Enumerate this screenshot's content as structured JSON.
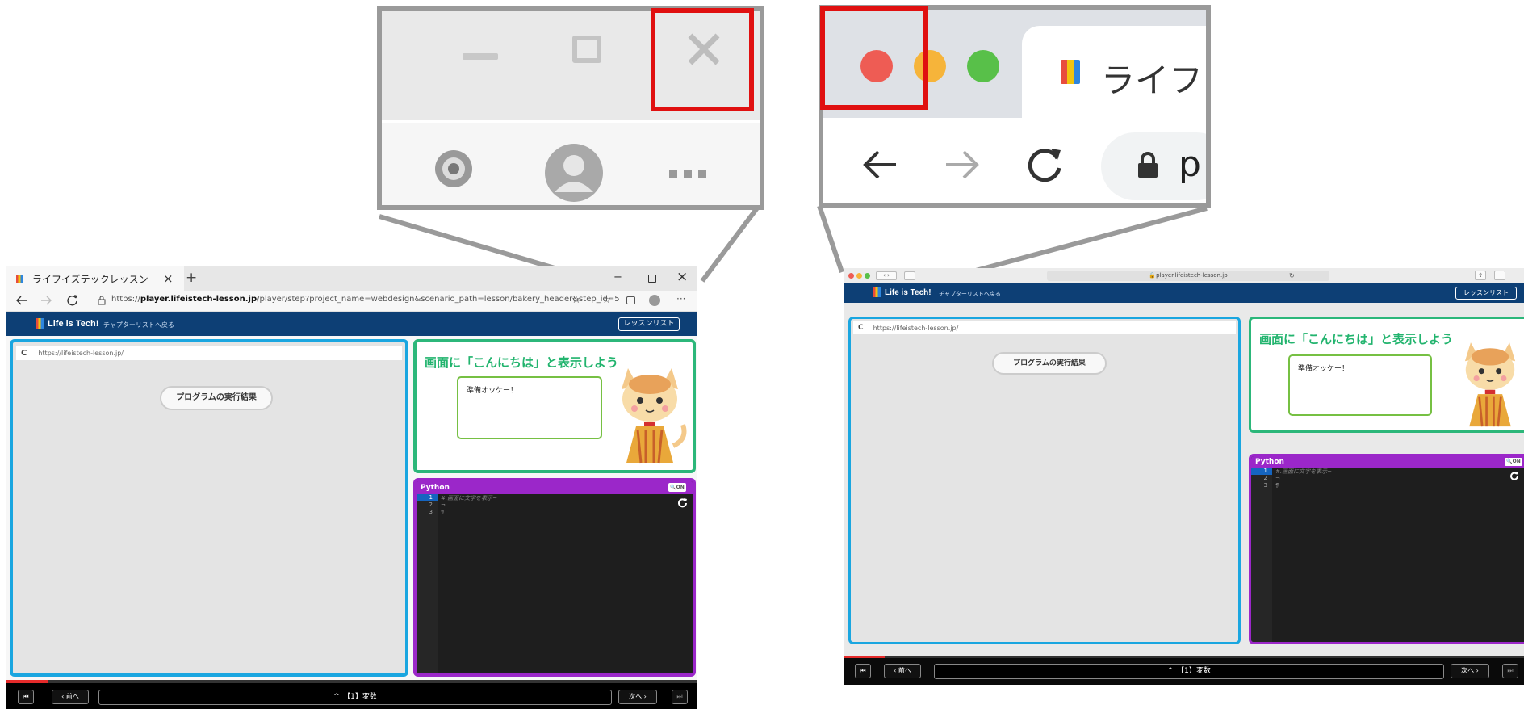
{
  "edge": {
    "tab_title": "ライフイズテックレッスン",
    "tab_close": "×",
    "new_tab": "+",
    "url_host": "player.lifeistech-lesson.jp",
    "url_prefix": "https://",
    "url_path": "/player/step?project_name=webdesign&scenario_path=lesson/bakery_header&step_id=5",
    "win_min": "−",
    "win_close": "×"
  },
  "safari": {
    "url": "player.lifeistech-lesson.jp"
  },
  "zoom_chrome": {
    "tab_text": "ライフ",
    "url_start": "p"
  },
  "lesson": {
    "logo_text": "Life is Tech!",
    "back_link": "チャプターリストへ戻る",
    "lesson_list": "レッスンリスト",
    "preview_url": "https://lifeistech-lesson.jp/",
    "exec_result": "プログラムの実行結果",
    "mission_title": "画面に「こんにちは」と表示しよう",
    "bubble_text": "準備オッケー！",
    "editor_lang": "Python",
    "editor_toggle": "ON",
    "code_lines": [
      "1",
      "2",
      "3"
    ],
    "code_line1": "#.画面に文字を表示~",
    "code_line2": "¬",
    "code_line3": "¶",
    "prev_label": "前へ",
    "next_label": "次へ",
    "chapter_label": "【1】変数",
    "chevron_up": "^",
    "progress": 0.06
  }
}
